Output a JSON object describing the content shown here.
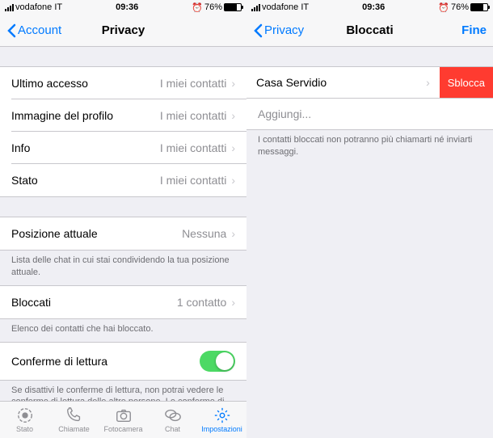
{
  "status": {
    "carrier": "vodafone IT",
    "time": "09:36",
    "battery": "76%"
  },
  "left": {
    "nav": {
      "back": "Account",
      "title": "Privacy"
    },
    "rows": {
      "lastseen": {
        "label": "Ultimo accesso",
        "value": "I miei contatti"
      },
      "photo": {
        "label": "Immagine del profilo",
        "value": "I miei contatti"
      },
      "info": {
        "label": "Info",
        "value": "I miei contatti"
      },
      "status": {
        "label": "Stato",
        "value": "I miei contatti"
      },
      "live": {
        "label": "Posizione attuale",
        "value": "Nessuna",
        "caption": "Lista delle chat in cui stai condividendo la tua posizione attuale."
      },
      "blocked": {
        "label": "Bloccati",
        "value": "1 contatto",
        "caption": "Elenco dei contatti che hai bloccato."
      },
      "receipts": {
        "label": "Conferme di lettura",
        "caption": "Se disattivi le conferme di lettura, non potrai vedere le conferme di lettura delle altre persone. Le conferme di lettura vengono sempre inviate per le chat di gruppo."
      }
    },
    "tabs": {
      "status": "Stato",
      "calls": "Chiamate",
      "camera": "Fotocamera",
      "chat": "Chat",
      "settings": "Impostazioni"
    }
  },
  "right": {
    "nav": {
      "back": "Privacy",
      "title": "Bloccati",
      "done": "Fine"
    },
    "contact": "Casa Servidio",
    "unblock": "Sblocca",
    "add": "Aggiungi...",
    "caption": "I contatti bloccati non potranno più chiamarti né inviarti messaggi."
  }
}
